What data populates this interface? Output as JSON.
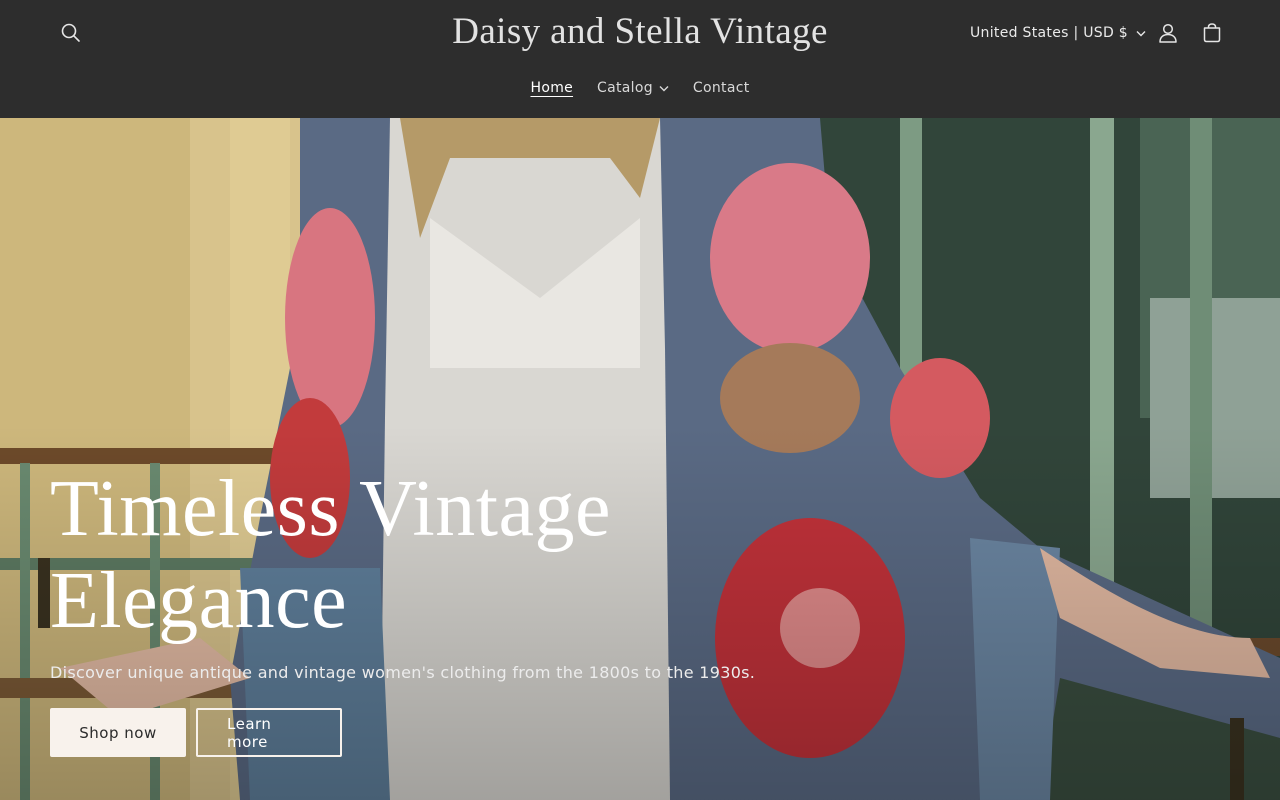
{
  "header": {
    "logo": "Daisy and Stella Vintage",
    "currency": "United States | USD $",
    "icons": {
      "search": "search-icon",
      "account": "user-icon",
      "cart": "bag-icon",
      "chevron": "chevron-down-icon"
    },
    "nav": [
      {
        "label": "Home",
        "active": true
      },
      {
        "label": "Catalog",
        "dropdown": true
      },
      {
        "label": "Contact"
      }
    ]
  },
  "hero": {
    "title_line1": "Timeless Vintage",
    "title_line2": "Elegance",
    "subtitle": "Discover unique antique and vintage women's clothing from the 1800s to the 1930s.",
    "primary_button": "Shop now",
    "secondary_button": "Learn more"
  },
  "colors": {
    "header_bg": "#2d2d2d",
    "button_bg": "#f8f2ec",
    "button_text": "#2b2b2b"
  }
}
